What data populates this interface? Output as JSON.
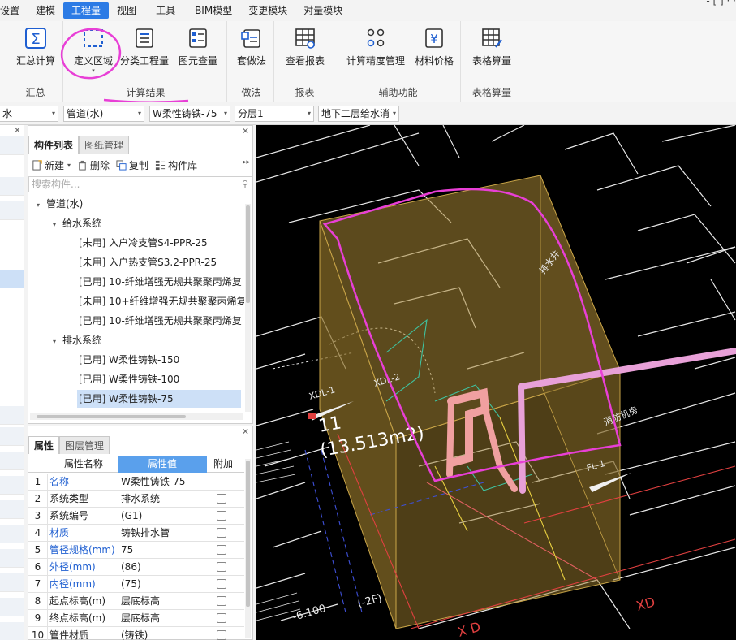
{
  "menu": {
    "items": [
      "设置",
      "建模",
      "工程量",
      "视图",
      "工具",
      "BIM模型",
      "变更模块",
      "对量模块"
    ],
    "active_index": 2,
    "right_text": "- [ ] · ·"
  },
  "ribbon": {
    "groups": [
      {
        "label": "汇总",
        "buttons": [
          {
            "label": "汇总计算",
            "icon": "sigma-icon"
          }
        ]
      },
      {
        "label": "计算结果",
        "buttons": [
          {
            "label": "定义区域",
            "icon": "dashed-region-icon"
          },
          {
            "label": "分类工程量",
            "icon": "classified-list-icon"
          },
          {
            "label": "图元查量",
            "icon": "element-query-icon"
          }
        ]
      },
      {
        "label": "做法",
        "buttons": [
          {
            "label": "套做法",
            "icon": "apply-method-icon"
          }
        ]
      },
      {
        "label": "报表",
        "buttons": [
          {
            "label": "查看报表",
            "icon": "report-grid-icon"
          }
        ]
      },
      {
        "label": "辅助功能",
        "buttons": [
          {
            "label": "计算精度管理",
            "icon": "precision-icon"
          },
          {
            "label": "材料价格",
            "icon": "yen-price-icon"
          }
        ]
      },
      {
        "label": "表格算量",
        "buttons": [
          {
            "label": "表格算量",
            "icon": "table-edit-icon"
          }
        ]
      }
    ]
  },
  "selectors": {
    "s1": "水",
    "s2": "管道(水)",
    "s3": "W柔性铸铁-75",
    "s4": "分层1",
    "s5": "地下二层给水消"
  },
  "component_panel": {
    "tabs": [
      "构件列表",
      "图纸管理"
    ],
    "toolbar": {
      "new": "新建",
      "delete": "删除",
      "copy": "复制",
      "library": "构件库"
    },
    "search_placeholder": "搜索构件...",
    "tree": [
      {
        "text": "管道(水)",
        "level": 0,
        "toggle": "▾"
      },
      {
        "text": "给水系统",
        "level": 1,
        "toggle": "▾"
      },
      {
        "text": "[未用] 入户冷支管S4-PPR-25",
        "level": 2
      },
      {
        "text": "[未用] 入户热支管S3.2-PPR-25",
        "level": 2
      },
      {
        "text": "[已用] 10-纤维增强无规共聚聚丙烯复",
        "level": 2
      },
      {
        "text": "[未用] 10+纤维增强无规共聚聚丙烯复",
        "level": 2
      },
      {
        "text": "[已用] 10-纤维增强无规共聚聚丙烯复",
        "level": 2
      },
      {
        "text": "排水系统",
        "level": 1,
        "toggle": "▾"
      },
      {
        "text": "[已用] W柔性铸铁-150",
        "level": 2
      },
      {
        "text": "[已用] W柔性铸铁-100",
        "level": 2
      },
      {
        "text": "[已用] W柔性铸铁-75",
        "level": 2,
        "selected": true
      }
    ]
  },
  "props_panel": {
    "tabs": [
      "属性",
      "图层管理"
    ],
    "headers": {
      "name": "属性名称",
      "value": "属性值",
      "extra": "附加"
    },
    "rows": [
      {
        "num": "1",
        "name": "名称",
        "value": "W柔性铸铁-75",
        "blue": true,
        "check": false
      },
      {
        "num": "2",
        "name": "系统类型",
        "value": "排水系统",
        "blue": false,
        "check": true
      },
      {
        "num": "3",
        "name": "系统编号",
        "value": "(G1)",
        "blue": false,
        "check": true
      },
      {
        "num": "4",
        "name": "材质",
        "value": "铸铁排水管",
        "blue": true,
        "check": true
      },
      {
        "num": "5",
        "name": "管径规格(mm)",
        "value": "75",
        "blue": true,
        "check": true
      },
      {
        "num": "6",
        "name": "外径(mm)",
        "value": "(86)",
        "blue": true,
        "check": true
      },
      {
        "num": "7",
        "name": "内径(mm)",
        "value": "(75)",
        "blue": true,
        "check": true
      },
      {
        "num": "8",
        "name": "起点标高(m)",
        "value": "层底标高",
        "blue": false,
        "check": true
      },
      {
        "num": "9",
        "name": "终点标高(m)",
        "value": "层底标高",
        "blue": false,
        "check": true
      },
      {
        "num": "10",
        "name": "管件材质",
        "value": "(铸铁)",
        "blue": false,
        "check": true
      }
    ]
  },
  "viewport": {
    "region_label": "11",
    "region_area": "(13.513m2)",
    "cad_texts": [
      "排水井",
      "XDL-1",
      "XDL-2",
      "消防机房",
      "FL-1",
      "-6.100",
      "(-2F)",
      "XD",
      "X D"
    ],
    "colors": {
      "region_fill": "#a78634",
      "annotation": "#e83fd6",
      "pipe": "#e8a0d8",
      "accent": "#2c7be5"
    }
  }
}
